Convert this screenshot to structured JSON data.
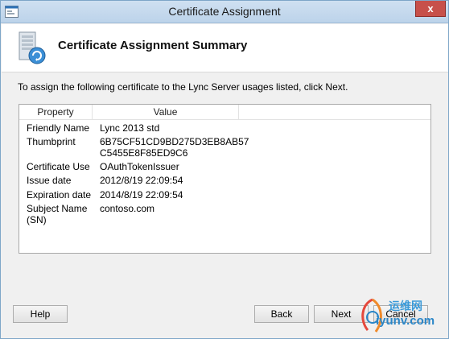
{
  "window": {
    "title": "Certificate Assignment",
    "close_label": "x"
  },
  "header": {
    "title": "Certificate Assignment Summary"
  },
  "instruction": "To assign the following certificate to the Lync Server usages listed, click Next.",
  "list": {
    "columns": [
      "Property",
      "Value"
    ],
    "rows": [
      {
        "property": "Friendly Name",
        "value": "Lync 2013 std"
      },
      {
        "property": "Thumbprint",
        "value": "6B75CF51CD9BD275D3EB8AB57",
        "value2": "C5455E8F85ED9C6"
      },
      {
        "property": "Certificate Use",
        "value": "OAuthTokenIssuer"
      },
      {
        "property": "Issue date",
        "value": "2012/8/19 22:09:54"
      },
      {
        "property": "Expiration date",
        "value": "2014/8/19 22:09:54"
      },
      {
        "property": "Subject Name",
        "property2": "(SN)",
        "value": "contoso.com"
      }
    ]
  },
  "buttons": {
    "help": "Help",
    "back": "Back",
    "next": "Next",
    "cancel": "Cancel"
  },
  "watermark": {
    "line1": "运维网",
    "line2": "iyunv.com"
  }
}
